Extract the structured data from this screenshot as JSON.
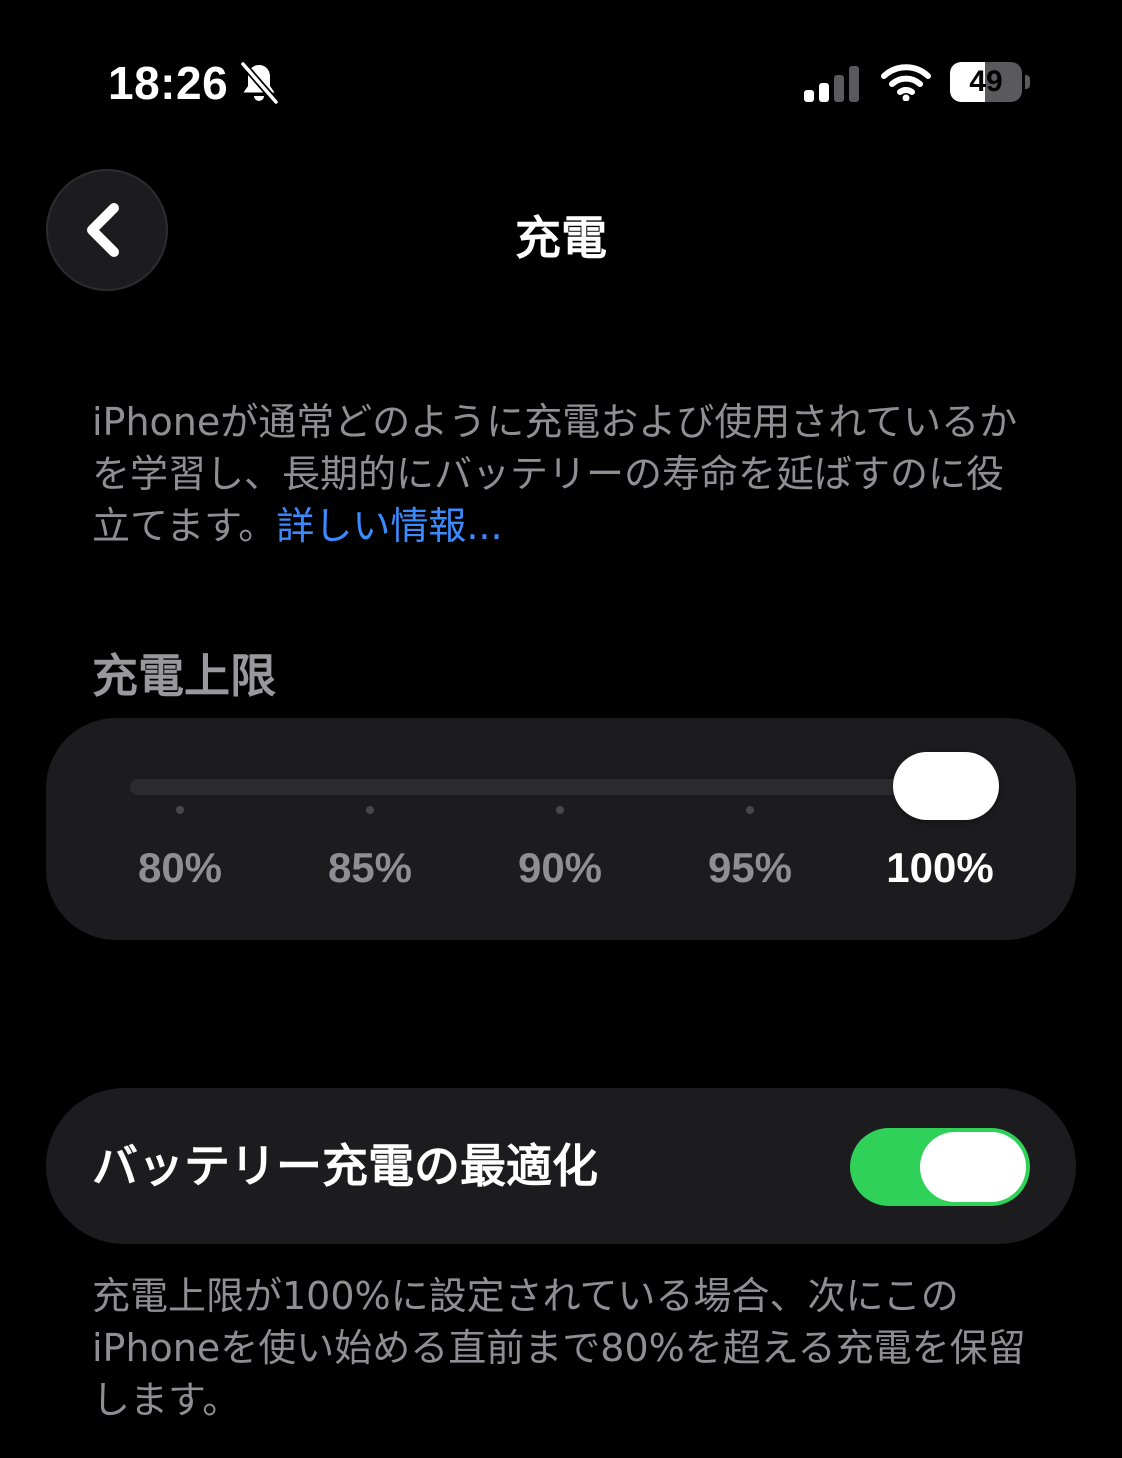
{
  "status_bar": {
    "time": "18:26",
    "battery_level": "49",
    "battery_fraction": 0.49,
    "icons": [
      "bell-slash-icon",
      "cellular-signal-icon",
      "wifi-icon",
      "battery-icon"
    ]
  },
  "nav": {
    "back_icon": "chevron-left-icon",
    "title": "充電"
  },
  "description": {
    "text": "iPhoneが通常どのように充電および使用されているかを学習し、長期的にバッテリーの寿命を延ばすのに役立てます。",
    "link": "詳しい情報..."
  },
  "charge_limit": {
    "heading": "充電上限",
    "options": [
      "80%",
      "85%",
      "90%",
      "95%",
      "100%"
    ],
    "selected_index": 4,
    "value_percent": 100
  },
  "optimized_charging": {
    "label": "バッテリー充電の最適化",
    "enabled": true,
    "footnote": "充電上限が100%に設定されている場合、次にこのiPhoneを使い始める直前まで80%を超える充電を保留します。"
  },
  "colors": {
    "background": "#000000",
    "card": "#1c1c1e",
    "accent_link": "#3a8bff",
    "toggle_on": "#30d158",
    "secondary_text": "#8e8e93"
  }
}
